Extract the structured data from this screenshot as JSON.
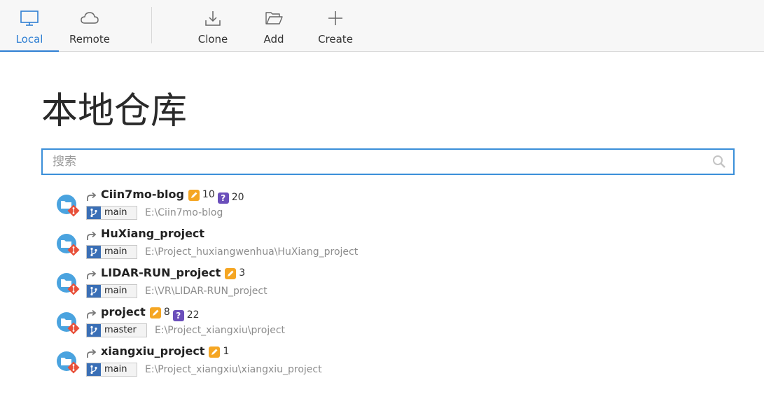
{
  "toolbar": {
    "local": {
      "label": "Local",
      "icon": "monitor-icon"
    },
    "remote": {
      "label": "Remote",
      "icon": "cloud-icon"
    },
    "clone": {
      "label": "Clone",
      "icon": "download-icon"
    },
    "add": {
      "label": "Add",
      "icon": "folder-open-icon"
    },
    "create": {
      "label": "Create",
      "icon": "plus-icon"
    },
    "accent_color": "#2f7fd3"
  },
  "page": {
    "title": "本地仓库"
  },
  "search": {
    "placeholder": "搜索",
    "value": ""
  },
  "repos": [
    {
      "name": "Ciin7mo-blog",
      "modified": "10",
      "untracked": "20",
      "branch": "main",
      "path": "E:\\Ciin7mo-blog"
    },
    {
      "name": "HuXiang_project",
      "modified": "",
      "untracked": "",
      "branch": "main",
      "path": "E:\\Project_huxiangwenhua\\HuXiang_project"
    },
    {
      "name": "LIDAR-RUN_project",
      "modified": "3",
      "untracked": "",
      "branch": "main",
      "path": "E:\\VR\\LIDAR-RUN_project"
    },
    {
      "name": "project",
      "modified": "8",
      "untracked": "22",
      "branch": "master",
      "path": "E:\\Project_xiangxiu\\project"
    },
    {
      "name": "xiangxiu_project",
      "modified": "1",
      "untracked": "",
      "branch": "main",
      "path": "E:\\Project_xiangxiu\\xiangxiu_project"
    }
  ],
  "colors": {
    "modified_badge": "#f5a623",
    "untracked_badge": "#6b4fbb",
    "branch_icon": "#3a6fb6",
    "repo_icon": "#4aa3df",
    "git_icon": "#e8503a"
  }
}
